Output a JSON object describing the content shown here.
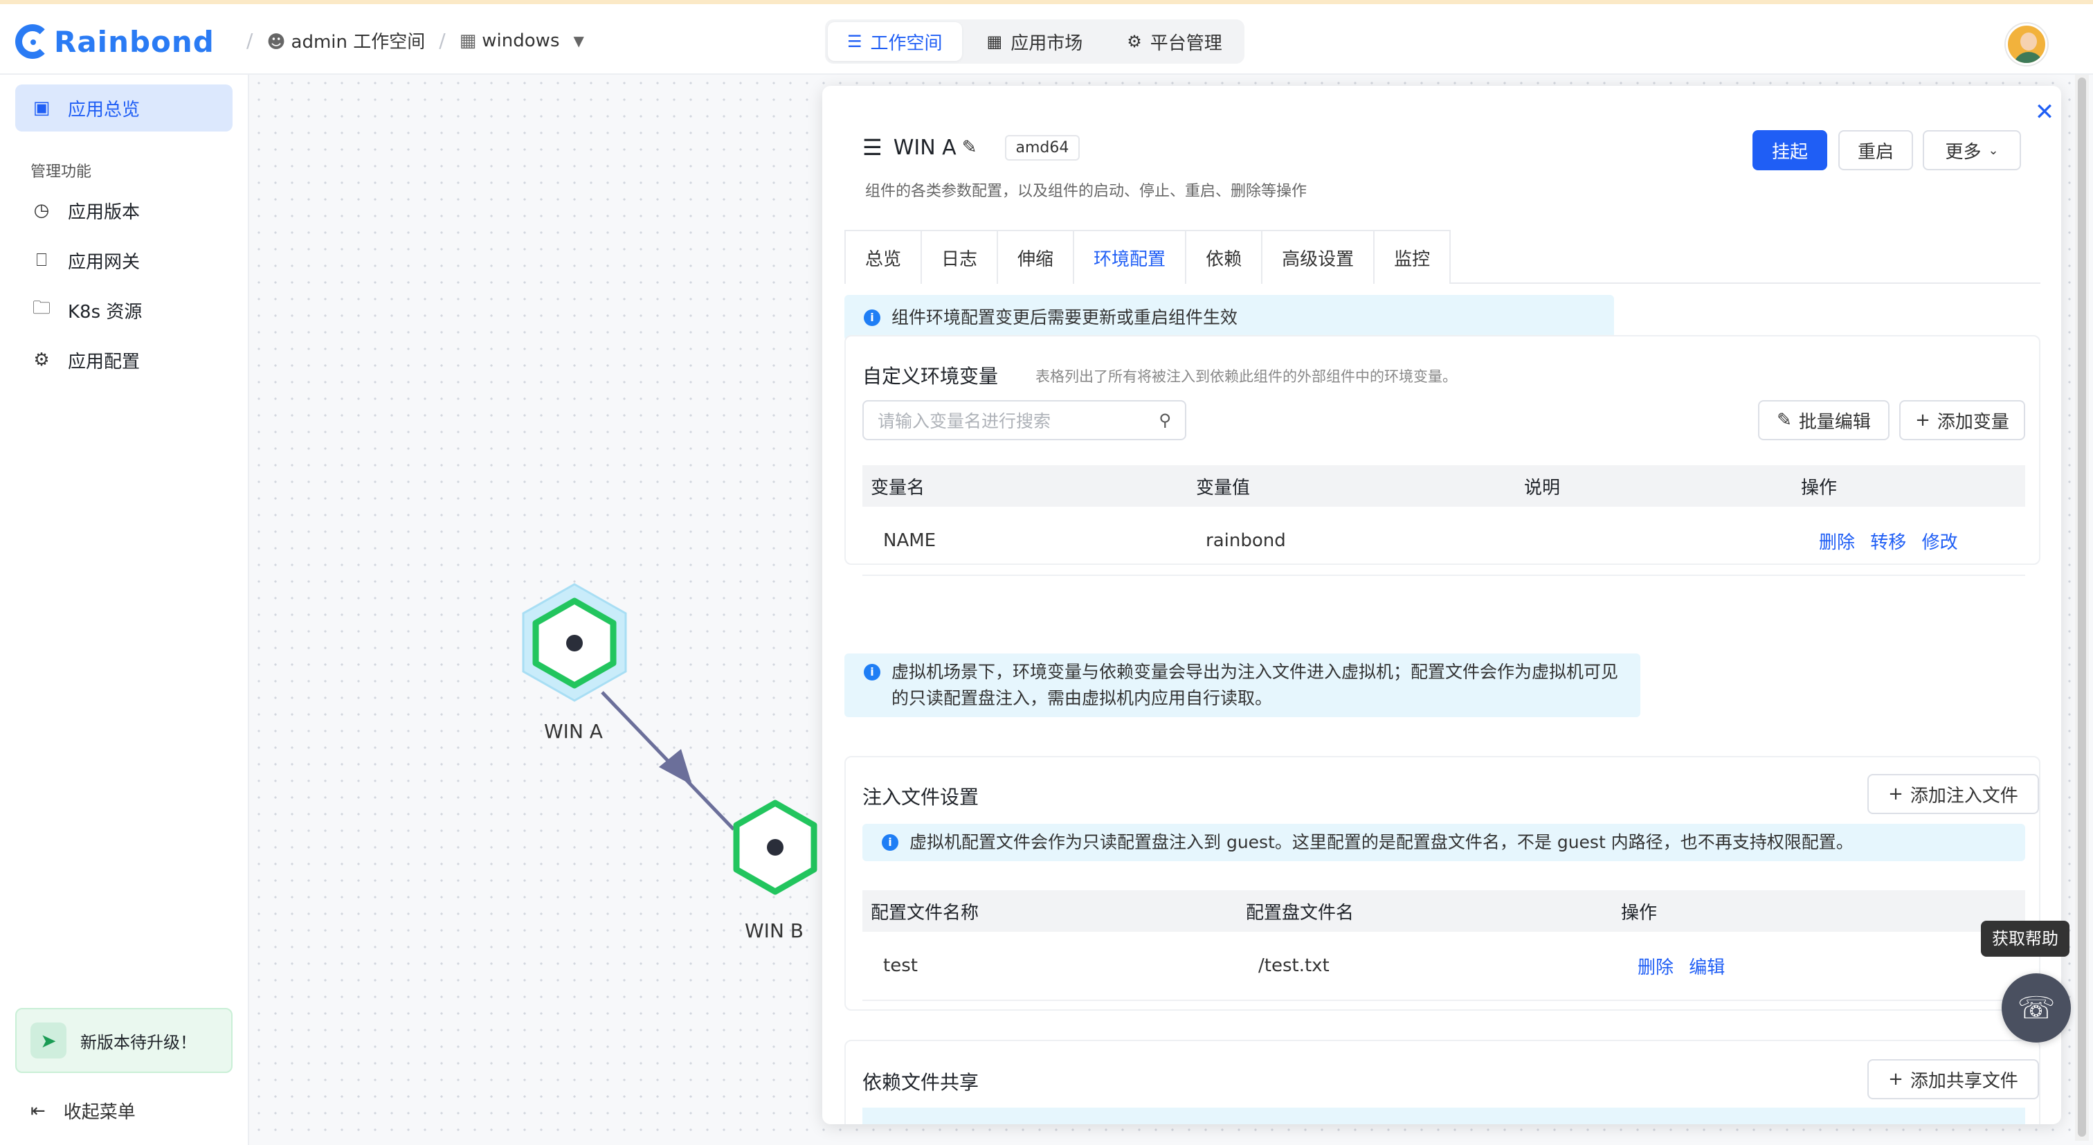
{
  "header": {
    "logo_text": "Rainbond",
    "breadcrumb": {
      "workspace": "admin 工作空间",
      "app": "windows"
    },
    "nav": [
      {
        "label": "工作空间",
        "icon": "layers-icon",
        "active": true
      },
      {
        "label": "应用市场",
        "icon": "grid-icon",
        "active": false
      },
      {
        "label": "平台管理",
        "icon": "gear-icon",
        "active": false
      }
    ]
  },
  "sidebar": {
    "top_item": "应用总览",
    "section_title": "管理功能",
    "items": [
      {
        "label": "应用版本",
        "icon": "clock-icon"
      },
      {
        "label": "应用网关",
        "icon": "router-icon"
      },
      {
        "label": "K8s 资源",
        "icon": "folder-icon"
      },
      {
        "label": "应用配置",
        "icon": "gear-icon"
      }
    ],
    "upgrade": "新版本待升级！",
    "collapse": "收起菜单"
  },
  "topology": {
    "nodes": [
      {
        "label": "WIN A",
        "selected": true
      },
      {
        "label": "WIN B",
        "selected": false
      }
    ]
  },
  "drawer": {
    "title": "WIN A",
    "arch": "amd64",
    "subtitle": "组件的各类参数配置，以及组件的启动、停止、重启、删除等操作",
    "buttons": {
      "suspend": "挂起",
      "restart": "重启",
      "more": "更多"
    },
    "tabs": [
      "总览",
      "日志",
      "伸缩",
      "环境配置",
      "依赖",
      "高级设置",
      "监控"
    ],
    "active_tab": "环境配置",
    "env_notice": "组件环境配置变更后需要更新或重启组件生效",
    "env_card": {
      "title": "自定义环境变量",
      "desc": "表格列出了所有将被注入到依赖此组件的外部组件中的环境变量。",
      "search_placeholder": "请输入变量名进行搜索",
      "batch_edit": "批量编辑",
      "add_var": "添加变量",
      "columns": [
        "变量名",
        "变量值",
        "说明",
        "操作"
      ],
      "rows": [
        {
          "name": "NAME",
          "value": "rainbond",
          "desc": "",
          "actions": [
            "删除",
            "转移",
            "修改"
          ]
        }
      ]
    },
    "vm_notice": "虚拟机场景下，环境变量与依赖变量会导出为注入文件进入虚拟机；配置文件会作为虚拟机可见的只读配置盘注入，需由虚拟机内应用自行读取。",
    "inject_card": {
      "title": "注入文件设置",
      "add_btn": "添加注入文件",
      "notice": "虚拟机配置文件会作为只读配置盘注入到 guest。这里配置的是配置盘文件名，不是 guest 内路径，也不再支持权限配置。",
      "columns": [
        "配置文件名称",
        "配置盘文件名",
        "操作"
      ],
      "rows": [
        {
          "name": "test",
          "disk_file": "/test.txt",
          "actions": [
            "删除",
            "编辑"
          ]
        }
      ]
    },
    "share_card": {
      "title": "依赖文件共享",
      "add_btn": "添加共享文件"
    }
  },
  "help": {
    "tooltip": "获取帮助"
  },
  "colors": {
    "primary": "#1f5ef5",
    "node_green": "#22c55e",
    "edge": "#6b6f9a"
  }
}
